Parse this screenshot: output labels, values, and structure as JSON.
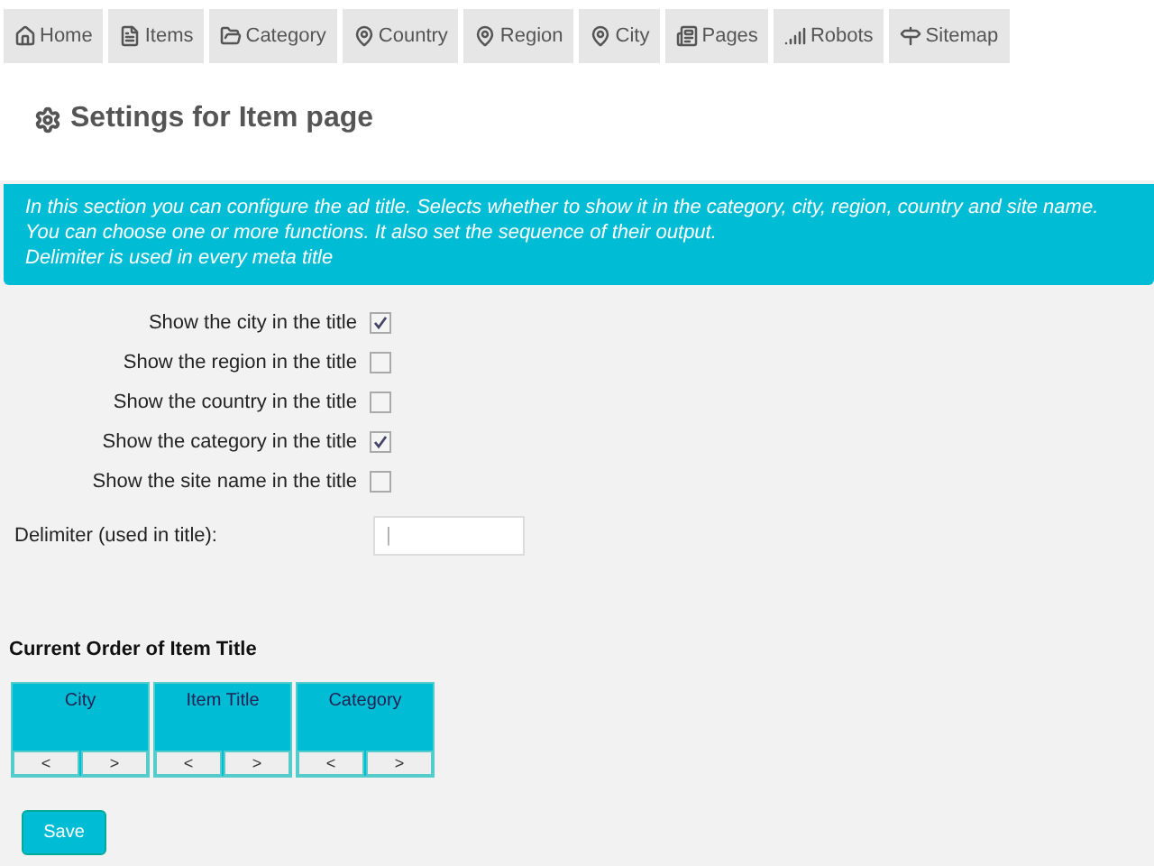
{
  "tabs": [
    {
      "label": "Home"
    },
    {
      "label": "Items"
    },
    {
      "label": "Category"
    },
    {
      "label": "Country"
    },
    {
      "label": "Region"
    },
    {
      "label": "City"
    },
    {
      "label": "Pages"
    },
    {
      "label": "Robots"
    },
    {
      "label": "Sitemap"
    }
  ],
  "heading": "Settings for Item page",
  "info": [
    "In this section you can configure the ad title. Selects whether to show it in the category, city, region, country and site name.",
    "You can choose one or more functions. It also set the sequence of their output.",
    "Delimiter is used in every meta title"
  ],
  "options": [
    {
      "label": "Show the city in the title",
      "checked": true
    },
    {
      "label": "Show the region in the title",
      "checked": false
    },
    {
      "label": "Show the country in the title",
      "checked": false
    },
    {
      "label": "Show the category in the title",
      "checked": true
    },
    {
      "label": "Show the site name in the title",
      "checked": false
    }
  ],
  "delimiter": {
    "label": "Delimiter (used in title):",
    "value": "|"
  },
  "order": {
    "title": "Current Order of Item Title",
    "items": [
      {
        "label": "City",
        "left": "<",
        "right": ">"
      },
      {
        "label": "Item Title",
        "left": "<",
        "right": ">"
      },
      {
        "label": "Category",
        "left": "<",
        "right": ">"
      }
    ]
  },
  "save": "Save"
}
